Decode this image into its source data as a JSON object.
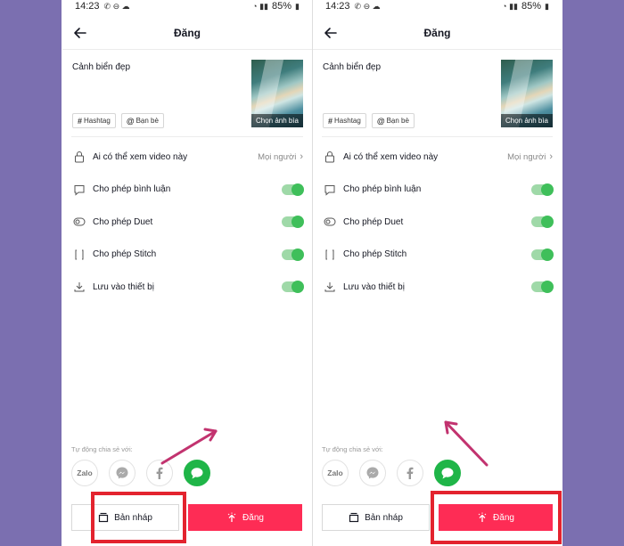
{
  "screens": [
    {
      "status": {
        "time": "14:23",
        "battery": "85%"
      },
      "header": {
        "title": "Đăng"
      },
      "caption": "Cảnh biển đẹp",
      "cover_label": "Chọn ảnh bìa",
      "chips": {
        "hashtag": "Hashtag",
        "friends": "Bạn bè"
      },
      "settings": {
        "privacy_label": "Ai có thể xem video này",
        "privacy_value": "Mọi người",
        "comments_label": "Cho phép bình luận",
        "duet_label": "Cho phép Duet",
        "stitch_label": "Cho phép Stitch",
        "save_label": "Lưu vào thiết bị"
      },
      "share": {
        "label": "Tự động chia sẻ với:",
        "zalo": "Zalo"
      },
      "buttons": {
        "draft": "Bản nháp",
        "post": "Đăng"
      }
    },
    {
      "status": {
        "time": "14:23",
        "battery": "85%"
      },
      "header": {
        "title": "Đăng"
      },
      "caption": "Cảnh biển đẹp",
      "cover_label": "Chọn ảnh bìa",
      "chips": {
        "hashtag": "Hashtag",
        "friends": "Bạn bè"
      },
      "settings": {
        "privacy_label": "Ai có thể xem video này",
        "privacy_value": "Mọi người",
        "comments_label": "Cho phép bình luận",
        "duet_label": "Cho phép Duet",
        "stitch_label": "Cho phép Stitch",
        "save_label": "Lưu vào thiết bị"
      },
      "share": {
        "label": "Tự động chia sẻ với:",
        "zalo": "Zalo"
      },
      "buttons": {
        "draft": "Bản nháp",
        "post": "Đăng"
      }
    }
  ],
  "colors": {
    "background": "#7b6fb0",
    "accent": "#fe2c55",
    "toggle_on": "#3fbf5a",
    "highlight": "#e3232e",
    "arrow": "#c2336f"
  },
  "icons": [
    "back-arrow-icon",
    "lock-icon",
    "comment-icon",
    "duet-icon",
    "stitch-icon",
    "download-icon",
    "chevron-right-icon",
    "messenger-icon",
    "facebook-icon",
    "message-bubble-icon",
    "draft-icon",
    "upload-icon"
  ]
}
